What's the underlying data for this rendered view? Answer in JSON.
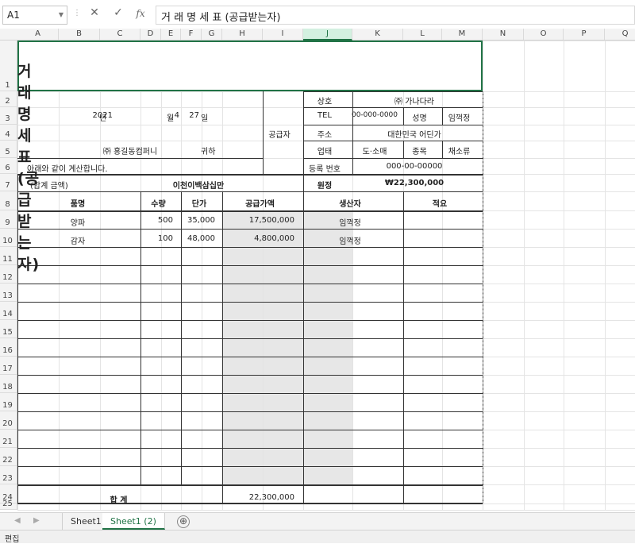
{
  "formula_bar": {
    "cell_ref": "A1",
    "cancel_icon": "✕",
    "enter_icon": "✓",
    "fx_label": "fx",
    "content": "거 래 명 세 표 (공급받는자)"
  },
  "columns": [
    "A",
    "B",
    "C",
    "D",
    "E",
    "F",
    "G",
    "H",
    "I",
    "J",
    "K",
    "L",
    "M",
    "N",
    "O",
    "P",
    "Q"
  ],
  "selected_column": "J",
  "rows": [
    "1",
    "2",
    "3",
    "4",
    "5",
    "6",
    "7",
    "8",
    "9",
    "10",
    "11",
    "12",
    "13",
    "14",
    "15",
    "16",
    "17",
    "18",
    "19",
    "20",
    "21",
    "22",
    "23",
    "24",
    "25"
  ],
  "invoice": {
    "title": "거 래 명 세 표 (공급받는자)",
    "date": {
      "year": "2021",
      "year_unit": "년",
      "month": "4",
      "month_unit": "월",
      "day": "27",
      "day_unit": "일"
    },
    "recipient": {
      "name": "㈜ 홍길동컴퍼니",
      "suffix": "귀하"
    },
    "intro": "아래와 같이 계산합니다.",
    "total_label": "(합계 금액)",
    "total_words": "이천이백삼십만",
    "won_label": "원정",
    "total_amount": "₩22,300,000",
    "supplier_label": "공급자",
    "supplier": {
      "company_label": "상호",
      "company": "㈜ 가나다라",
      "tel_label": "TEL",
      "tel": "00-000-0000",
      "name_label": "성명",
      "name": "임꺽정",
      "address_label": "주소",
      "address": "대한민국 어딘가",
      "business_label": "업태",
      "business": "도·소매",
      "type_label": "종목",
      "type": "채소류",
      "reg_label": "등록 번호",
      "reg": "000-00-00000"
    },
    "headers": {
      "item": "품명",
      "qty": "수량",
      "price": "단가",
      "amount": "공급가액",
      "producer": "생산자",
      "note": "적요"
    },
    "items": [
      {
        "item": "양파",
        "qty": "500",
        "price": "35,000",
        "amount": "17,500,000",
        "producer": "임꺽정"
      },
      {
        "item": "감자",
        "qty": "100",
        "price": "48,000",
        "amount": "4,800,000",
        "producer": "임꺽정"
      }
    ],
    "sum_label": "합  계",
    "sum_amount": "22,300,000"
  },
  "sheet_tabs": [
    "Sheet1",
    "Sheet1 (2)"
  ],
  "active_sheet": "Sheet1 (2)",
  "add_sheet_icon": "⊕",
  "status_text": "편집",
  "colors": {
    "accent": "#217346",
    "shade": "#e7e7e7"
  }
}
